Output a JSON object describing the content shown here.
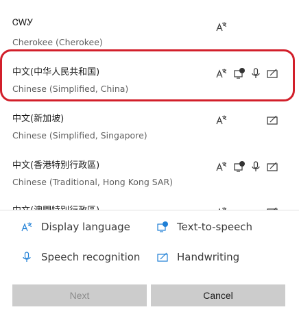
{
  "languages": [
    {
      "native": "ᏣᎳᎩ",
      "english": "Cherokee (Cherokee)"
    },
    {
      "native": "中文(中华人民共和国)",
      "english": "Chinese (Simplified, China)"
    },
    {
      "native": "中文(新加坡)",
      "english": "Chinese (Simplified, Singapore)"
    },
    {
      "native": "中文(香港特別行政區)",
      "english": "Chinese (Traditional, Hong Kong SAR)"
    },
    {
      "native": "中文(澳門特別行政區)",
      "english": ""
    }
  ],
  "legend": {
    "display_language": "Display language",
    "text_to_speech": "Text-to-speech",
    "speech_recognition": "Speech recognition",
    "handwriting": "Handwriting"
  },
  "buttons": {
    "next": "Next",
    "cancel": "Cancel"
  },
  "colors": {
    "selection_border": "#d21f2a",
    "accent": "#1f7fd6",
    "button_bg": "#cccccc"
  }
}
